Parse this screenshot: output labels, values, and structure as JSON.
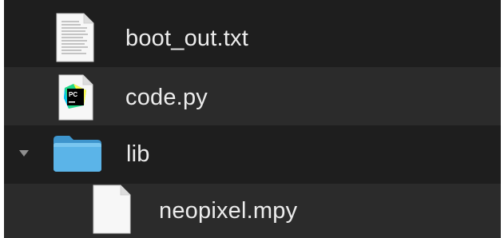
{
  "files": [
    {
      "name": "boot_out.txt",
      "icon": "text-file-icon"
    },
    {
      "name": "code.py",
      "icon": "pycharm-file-icon",
      "badge": "PC"
    },
    {
      "name": "lib",
      "icon": "folder-icon",
      "disclosure": "expanded"
    },
    {
      "name": "neopixel.mpy",
      "icon": "blank-file-icon"
    }
  ],
  "colors": {
    "background": "#1e1e1e",
    "alt_row": "#2b2b2b",
    "text": "#ececec",
    "folder": "#4aa6dd"
  }
}
